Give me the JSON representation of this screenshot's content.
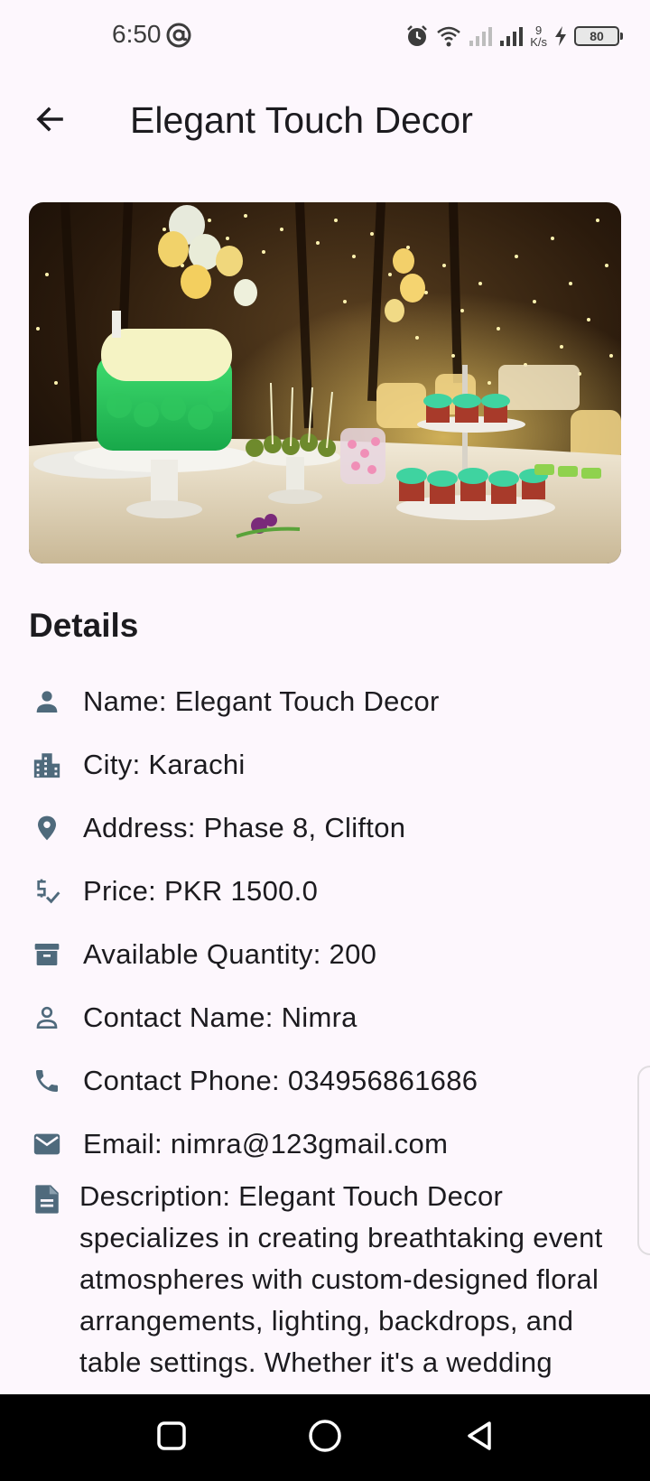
{
  "status_bar": {
    "time": "6:50",
    "net_speed_value": "9",
    "net_speed_unit": "K/s",
    "battery": "80"
  },
  "app_bar": {
    "title": "Elegant Touch Decor",
    "back_icon": "arrow-back-icon"
  },
  "hero": {
    "icon": "event-photo-cake-cupcakes-lights"
  },
  "details": {
    "heading": "Details",
    "rows": [
      {
        "icon": "person-icon",
        "text": "Name: Elegant Touch Decor"
      },
      {
        "icon": "city-icon",
        "text": "City: Karachi"
      },
      {
        "icon": "location-pin-icon",
        "text": "Address: Phase 8, Clifton"
      },
      {
        "icon": "price-check-icon",
        "text": "Price: PKR 1500.0"
      },
      {
        "icon": "inventory-box-icon",
        "text": "Available Quantity: 200"
      },
      {
        "icon": "person-outline-icon",
        "text": "Contact Name: Nimra"
      },
      {
        "icon": "phone-icon",
        "text": "Contact Phone: 034956861686"
      },
      {
        "icon": "email-icon",
        "text": "Email: nimra@123gmail.com"
      }
    ],
    "description": {
      "icon": "description-icon",
      "text": "Description: Elegant Touch Decor specializes in creating breathtaking event atmospheres with custom-designed floral arrangements, lighting, backdrops, and table settings. Whether it's a wedding"
    }
  },
  "colors": {
    "background": "#fdf7fd",
    "icon": "#4f6a7c",
    "text": "#1c1b1f"
  },
  "nav_bar": {
    "recents_icon": "square-recents-icon",
    "home_icon": "circle-home-icon",
    "back_icon": "triangle-back-icon"
  }
}
